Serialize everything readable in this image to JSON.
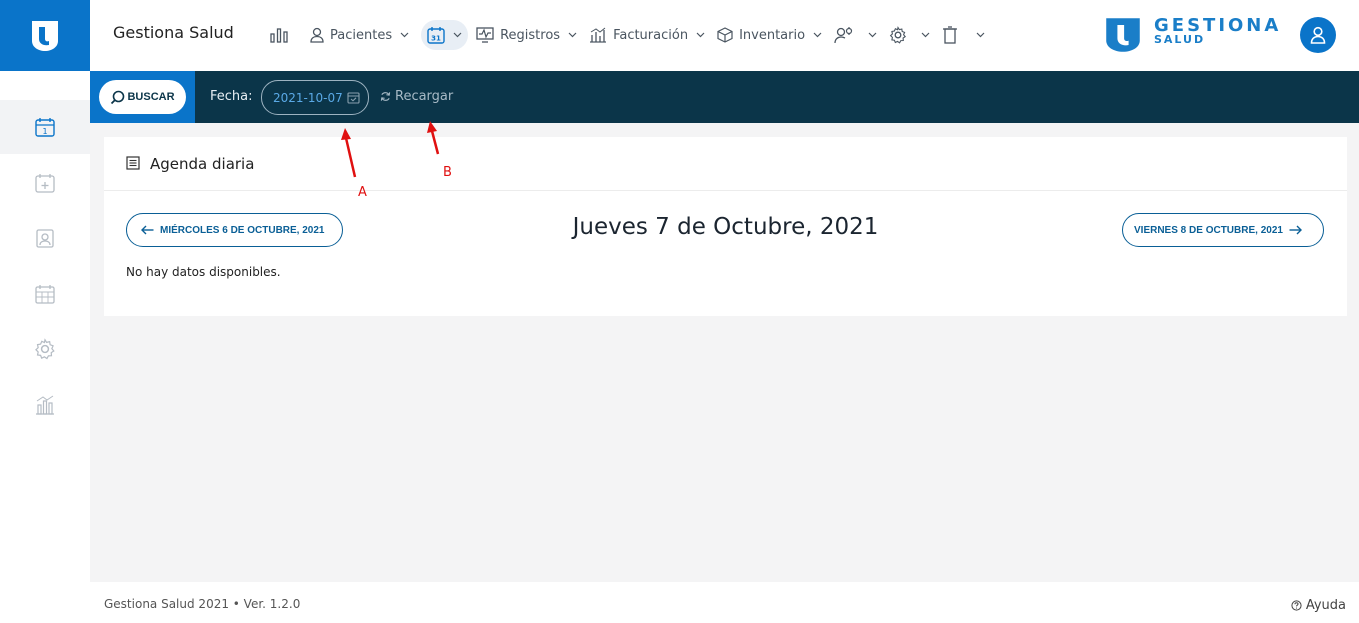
{
  "header": {
    "app_title": "Gestiona Salud",
    "brand_line1": "GESTIONA",
    "brand_line2": "SALUD",
    "nav": [
      {
        "icon": "bar-chart-icon",
        "label": ""
      },
      {
        "icon": "user-icon",
        "label": "Pacientes"
      },
      {
        "icon": "calendar-icon",
        "label": "31",
        "active": true
      },
      {
        "icon": "monitor-pulse-icon",
        "label": "Registros"
      },
      {
        "icon": "billing-chart-icon",
        "label": "Facturación"
      },
      {
        "icon": "box-icon",
        "label": "Inventario"
      },
      {
        "icon": "user-gear-icon",
        "label": ""
      },
      {
        "icon": "gear-icon",
        "label": ""
      },
      {
        "icon": "trash-icon",
        "label": ""
      }
    ]
  },
  "sidebar": {
    "items": [
      {
        "icon": "calendar-day-icon",
        "value": "1",
        "active": true
      },
      {
        "icon": "calendar-plus-icon"
      },
      {
        "icon": "contact-card-icon"
      },
      {
        "icon": "calendar-grid-icon"
      },
      {
        "icon": "gear-icon"
      },
      {
        "icon": "chart-bars-icon"
      }
    ]
  },
  "searchbar": {
    "search_label": "BUSCAR",
    "date_label": "Fecha:",
    "date_value": "2021-10-07",
    "reload_label": "Recargar"
  },
  "agenda": {
    "title": "Agenda diaria",
    "prev_label": "MIÉRCOLES 6 DE OCTUBRE, 2021",
    "next_label": "VIERNES 8 DE OCTUBRE, 2021",
    "day_title": "Jueves 7 de Octubre, 2021",
    "empty_message": "No hay datos disponibles."
  },
  "annotations": {
    "a": "A",
    "b": "B",
    "color": "#e01010"
  },
  "footer": {
    "version_text": "Gestiona Salud 2021 • Ver. 1.2.0",
    "help_label": "Ayuda"
  },
  "colors": {
    "primary": "#0a74c9",
    "dark_bar": "#0b3549",
    "background": "#f4f4f5"
  }
}
